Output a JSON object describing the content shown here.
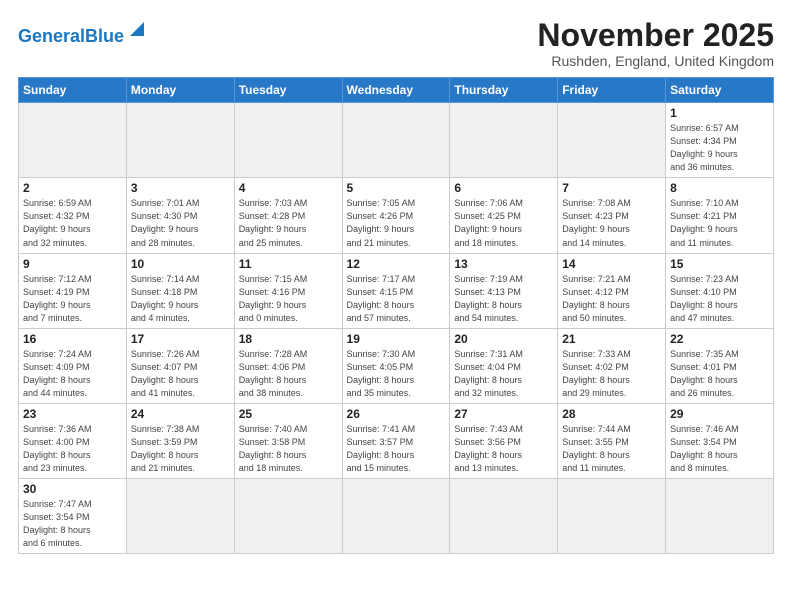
{
  "header": {
    "logo_general": "General",
    "logo_blue": "Blue",
    "month_title": "November 2025",
    "location": "Rushden, England, United Kingdom"
  },
  "days_of_week": [
    "Sunday",
    "Monday",
    "Tuesday",
    "Wednesday",
    "Thursday",
    "Friday",
    "Saturday"
  ],
  "weeks": [
    [
      {
        "day": "",
        "info": ""
      },
      {
        "day": "",
        "info": ""
      },
      {
        "day": "",
        "info": ""
      },
      {
        "day": "",
        "info": ""
      },
      {
        "day": "",
        "info": ""
      },
      {
        "day": "",
        "info": ""
      },
      {
        "day": "1",
        "info": "Sunrise: 6:57 AM\nSunset: 4:34 PM\nDaylight: 9 hours\nand 36 minutes."
      }
    ],
    [
      {
        "day": "2",
        "info": "Sunrise: 6:59 AM\nSunset: 4:32 PM\nDaylight: 9 hours\nand 32 minutes."
      },
      {
        "day": "3",
        "info": "Sunrise: 7:01 AM\nSunset: 4:30 PM\nDaylight: 9 hours\nand 28 minutes."
      },
      {
        "day": "4",
        "info": "Sunrise: 7:03 AM\nSunset: 4:28 PM\nDaylight: 9 hours\nand 25 minutes."
      },
      {
        "day": "5",
        "info": "Sunrise: 7:05 AM\nSunset: 4:26 PM\nDaylight: 9 hours\nand 21 minutes."
      },
      {
        "day": "6",
        "info": "Sunrise: 7:06 AM\nSunset: 4:25 PM\nDaylight: 9 hours\nand 18 minutes."
      },
      {
        "day": "7",
        "info": "Sunrise: 7:08 AM\nSunset: 4:23 PM\nDaylight: 9 hours\nand 14 minutes."
      },
      {
        "day": "8",
        "info": "Sunrise: 7:10 AM\nSunset: 4:21 PM\nDaylight: 9 hours\nand 11 minutes."
      }
    ],
    [
      {
        "day": "9",
        "info": "Sunrise: 7:12 AM\nSunset: 4:19 PM\nDaylight: 9 hours\nand 7 minutes."
      },
      {
        "day": "10",
        "info": "Sunrise: 7:14 AM\nSunset: 4:18 PM\nDaylight: 9 hours\nand 4 minutes."
      },
      {
        "day": "11",
        "info": "Sunrise: 7:15 AM\nSunset: 4:16 PM\nDaylight: 9 hours\nand 0 minutes."
      },
      {
        "day": "12",
        "info": "Sunrise: 7:17 AM\nSunset: 4:15 PM\nDaylight: 8 hours\nand 57 minutes."
      },
      {
        "day": "13",
        "info": "Sunrise: 7:19 AM\nSunset: 4:13 PM\nDaylight: 8 hours\nand 54 minutes."
      },
      {
        "day": "14",
        "info": "Sunrise: 7:21 AM\nSunset: 4:12 PM\nDaylight: 8 hours\nand 50 minutes."
      },
      {
        "day": "15",
        "info": "Sunrise: 7:23 AM\nSunset: 4:10 PM\nDaylight: 8 hours\nand 47 minutes."
      }
    ],
    [
      {
        "day": "16",
        "info": "Sunrise: 7:24 AM\nSunset: 4:09 PM\nDaylight: 8 hours\nand 44 minutes."
      },
      {
        "day": "17",
        "info": "Sunrise: 7:26 AM\nSunset: 4:07 PM\nDaylight: 8 hours\nand 41 minutes."
      },
      {
        "day": "18",
        "info": "Sunrise: 7:28 AM\nSunset: 4:06 PM\nDaylight: 8 hours\nand 38 minutes."
      },
      {
        "day": "19",
        "info": "Sunrise: 7:30 AM\nSunset: 4:05 PM\nDaylight: 8 hours\nand 35 minutes."
      },
      {
        "day": "20",
        "info": "Sunrise: 7:31 AM\nSunset: 4:04 PM\nDaylight: 8 hours\nand 32 minutes."
      },
      {
        "day": "21",
        "info": "Sunrise: 7:33 AM\nSunset: 4:02 PM\nDaylight: 8 hours\nand 29 minutes."
      },
      {
        "day": "22",
        "info": "Sunrise: 7:35 AM\nSunset: 4:01 PM\nDaylight: 8 hours\nand 26 minutes."
      }
    ],
    [
      {
        "day": "23",
        "info": "Sunrise: 7:36 AM\nSunset: 4:00 PM\nDaylight: 8 hours\nand 23 minutes."
      },
      {
        "day": "24",
        "info": "Sunrise: 7:38 AM\nSunset: 3:59 PM\nDaylight: 8 hours\nand 21 minutes."
      },
      {
        "day": "25",
        "info": "Sunrise: 7:40 AM\nSunset: 3:58 PM\nDaylight: 8 hours\nand 18 minutes."
      },
      {
        "day": "26",
        "info": "Sunrise: 7:41 AM\nSunset: 3:57 PM\nDaylight: 8 hours\nand 15 minutes."
      },
      {
        "day": "27",
        "info": "Sunrise: 7:43 AM\nSunset: 3:56 PM\nDaylight: 8 hours\nand 13 minutes."
      },
      {
        "day": "28",
        "info": "Sunrise: 7:44 AM\nSunset: 3:55 PM\nDaylight: 8 hours\nand 11 minutes."
      },
      {
        "day": "29",
        "info": "Sunrise: 7:46 AM\nSunset: 3:54 PM\nDaylight: 8 hours\nand 8 minutes."
      }
    ],
    [
      {
        "day": "30",
        "info": "Sunrise: 7:47 AM\nSunset: 3:54 PM\nDaylight: 8 hours\nand 6 minutes."
      },
      {
        "day": "",
        "info": ""
      },
      {
        "day": "",
        "info": ""
      },
      {
        "day": "",
        "info": ""
      },
      {
        "day": "",
        "info": ""
      },
      {
        "day": "",
        "info": ""
      },
      {
        "day": "",
        "info": ""
      }
    ]
  ]
}
